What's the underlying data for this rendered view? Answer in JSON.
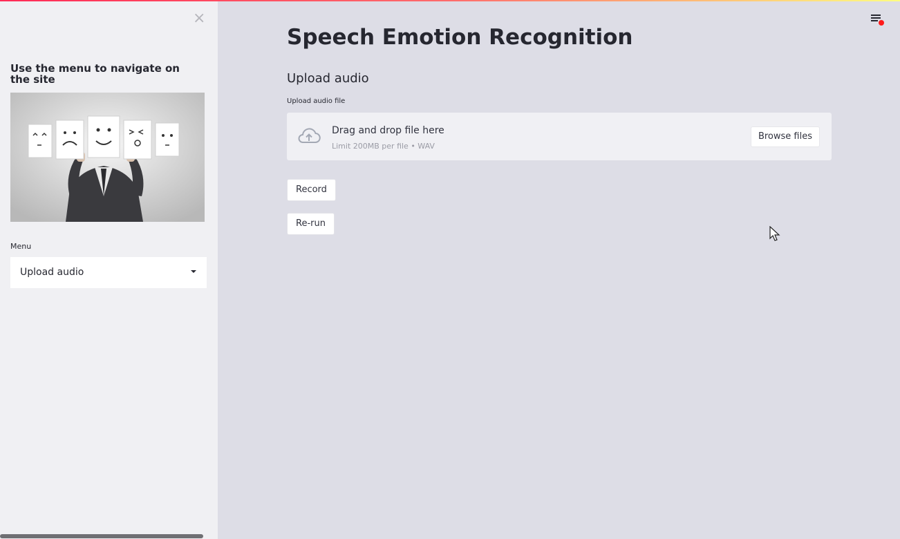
{
  "sidebar": {
    "close_icon": "close-icon",
    "close_glyph": "×",
    "title": "Use the menu to navigate on the site",
    "image_alt": "man-holding-emotion-face-cards",
    "menu_label": "Menu",
    "menu_selected": "Upload audio"
  },
  "header": {
    "menu_icon": "hamburger-icon",
    "status_dot_color": "#ff1a1a"
  },
  "main": {
    "title": "Speech Emotion Recognition",
    "section_title": "Upload audio",
    "uploader": {
      "label": "Upload audio file",
      "icon": "cloud-upload-icon",
      "drag_text": "Drag and drop file here",
      "limit_text": "Limit 200MB per file • WAV",
      "browse_label": "Browse files"
    },
    "record_label": "Record",
    "rerun_label": "Re-run"
  },
  "colors": {
    "accent_stripe_start": "#ff2b56",
    "accent_stripe_end": "#fffd80",
    "sidebar_bg": "#f0f0f3",
    "main_bg": "#dddde6",
    "text": "#262730"
  }
}
